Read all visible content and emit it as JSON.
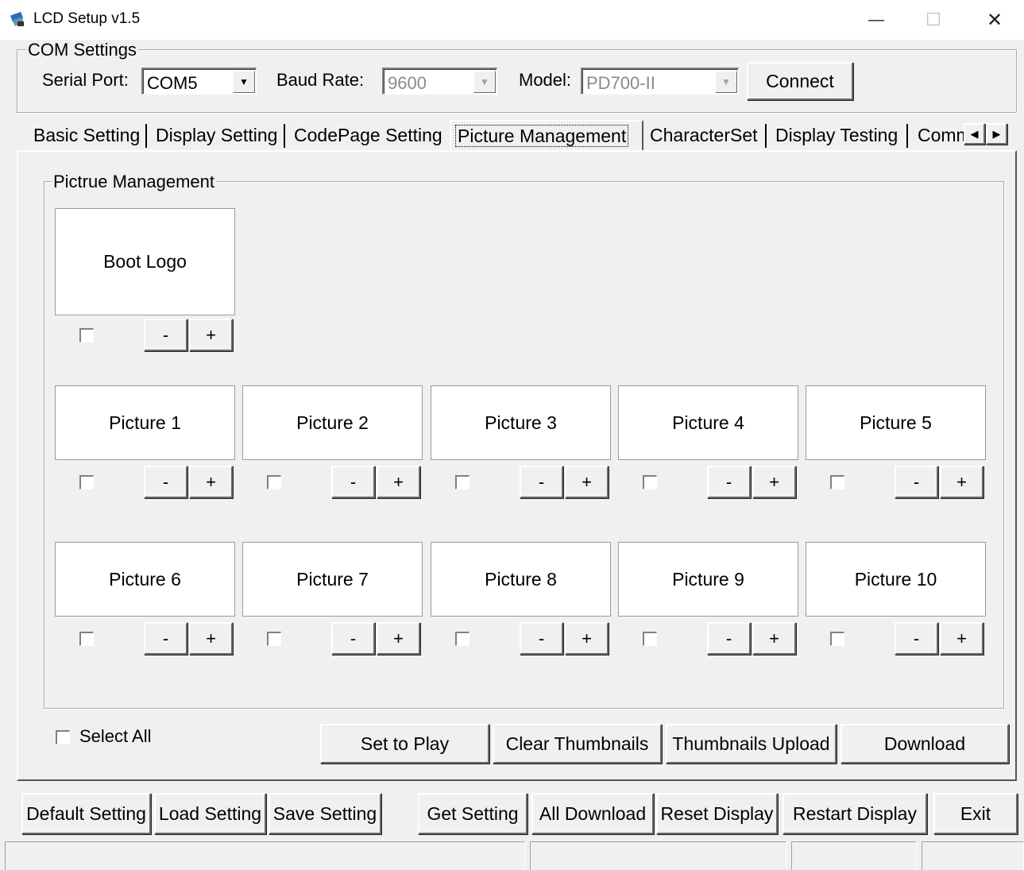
{
  "window": {
    "title": "LCD Setup v1.5",
    "minimize": "—",
    "maximize": "☐",
    "close": "✕"
  },
  "com": {
    "group_label": "COM Settings",
    "serial_port_label": "Serial Port:",
    "serial_port_value": "COM5",
    "baud_rate_label": "Baud Rate:",
    "baud_rate_value": "9600",
    "model_label": "Model:",
    "model_value": "PD700-II",
    "connect_label": "Connect"
  },
  "tabs": [
    {
      "label": "Basic Setting"
    },
    {
      "label": "Display Setting"
    },
    {
      "label": "CodePage Setting"
    },
    {
      "label": "Picture Management"
    },
    {
      "label": "CharacterSet"
    },
    {
      "label": "Display Testing"
    },
    {
      "label": "Comm"
    }
  ],
  "tab_scroll": {
    "left": "◀",
    "right": "▶"
  },
  "picture_group": {
    "label": "Pictrue Management",
    "boot_logo": "Boot Logo",
    "pictures": [
      {
        "label": "Picture 1"
      },
      {
        "label": "Picture 2"
      },
      {
        "label": "Picture 3"
      },
      {
        "label": "Picture 4"
      },
      {
        "label": "Picture 5"
      },
      {
        "label": "Picture 6"
      },
      {
        "label": "Picture 7"
      },
      {
        "label": "Picture 8"
      },
      {
        "label": "Picture 9"
      },
      {
        "label": "Picture 10"
      }
    ],
    "minus": "-",
    "plus": "+"
  },
  "actions": {
    "select_all": "Select All",
    "set_to_play": "Set to Play",
    "clear_thumbnails": "Clear Thumbnails",
    "thumbnails_upload": "Thumbnails Upload",
    "download": "Download"
  },
  "bottom": {
    "default_setting": "Default Setting",
    "load_setting": "Load Setting",
    "save_setting": "Save Setting",
    "get_setting": "Get Setting",
    "all_download": "All Download",
    "reset_display": "Reset Display",
    "restart_display": "Restart Display",
    "exit": "Exit"
  },
  "status": {
    "p1": "",
    "p2": "",
    "p3": "",
    "p4": ""
  }
}
